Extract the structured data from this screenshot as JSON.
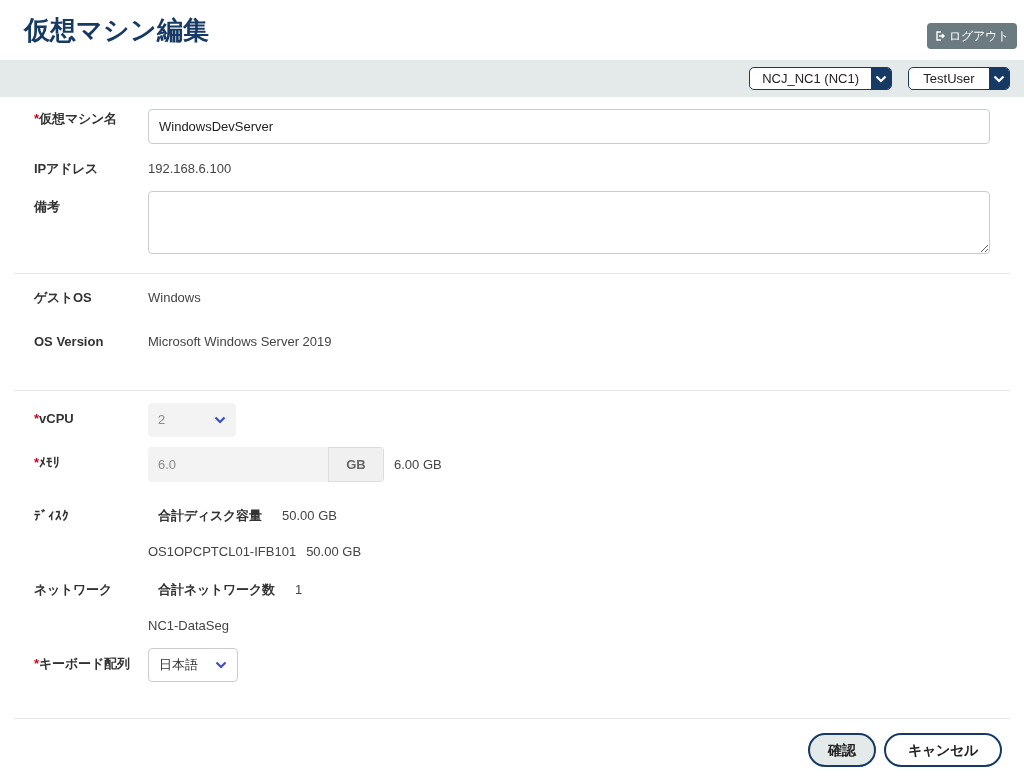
{
  "title": "仮想マシン編集",
  "logout_button": {
    "label": "ログアウト"
  },
  "header": {
    "selects": [
      {
        "value": "NCJ_NC1 (NC1)"
      },
      {
        "value": "TestUser"
      }
    ]
  },
  "sections": [
    {
      "rows": [
        {
          "kind": "text_input",
          "required_mark": "*",
          "label": "仮想マシン名",
          "value": "WindowsDevServer"
        },
        {
          "kind": "text",
          "label": "IPアドレス",
          "value": "192.168.6.100"
        },
        {
          "kind": "textarea",
          "label": "備考"
        }
      ]
    },
    {
      "rows": [
        {
          "kind": "text",
          "label": "ゲストOS",
          "value": "Windows"
        },
        {
          "kind": "text",
          "label": "OS Version",
          "value": "Microsoft Windows Server 2019"
        }
      ]
    },
    {
      "rows": [
        {
          "kind": "select",
          "required_mark": "*",
          "label": "vCPU",
          "value": "2",
          "disabled": true
        },
        {
          "kind": "unit_input",
          "required_mark": "*",
          "label": "ﾒﾓﾘ",
          "value": "6.0",
          "unit": "GB",
          "reading": "6.00 GB",
          "disabled": true
        },
        {
          "kind": "summary",
          "label": "ﾃﾞｨｽｸ",
          "total_label": "合計ディスク容量",
          "total": "50.00 GB",
          "items": [
            {
              "name": "OS1OPCPTCL01-IFB101",
              "size": "50.00 GB"
            }
          ]
        },
        {
          "kind": "summary",
          "label": "ネットワーク",
          "total_label": "合計ネットワーク数",
          "total": "1",
          "items": [
            {
              "name": "NC1-DataSeg"
            }
          ]
        },
        {
          "kind": "select",
          "required_mark": "*",
          "label": "キーボード配列",
          "value": "日本語",
          "disabled": false
        }
      ]
    }
  ],
  "buttons": [
    {
      "kind": "primary",
      "label": "確認"
    },
    {
      "kind": "secondary",
      "label": "キャンセル"
    }
  ]
}
